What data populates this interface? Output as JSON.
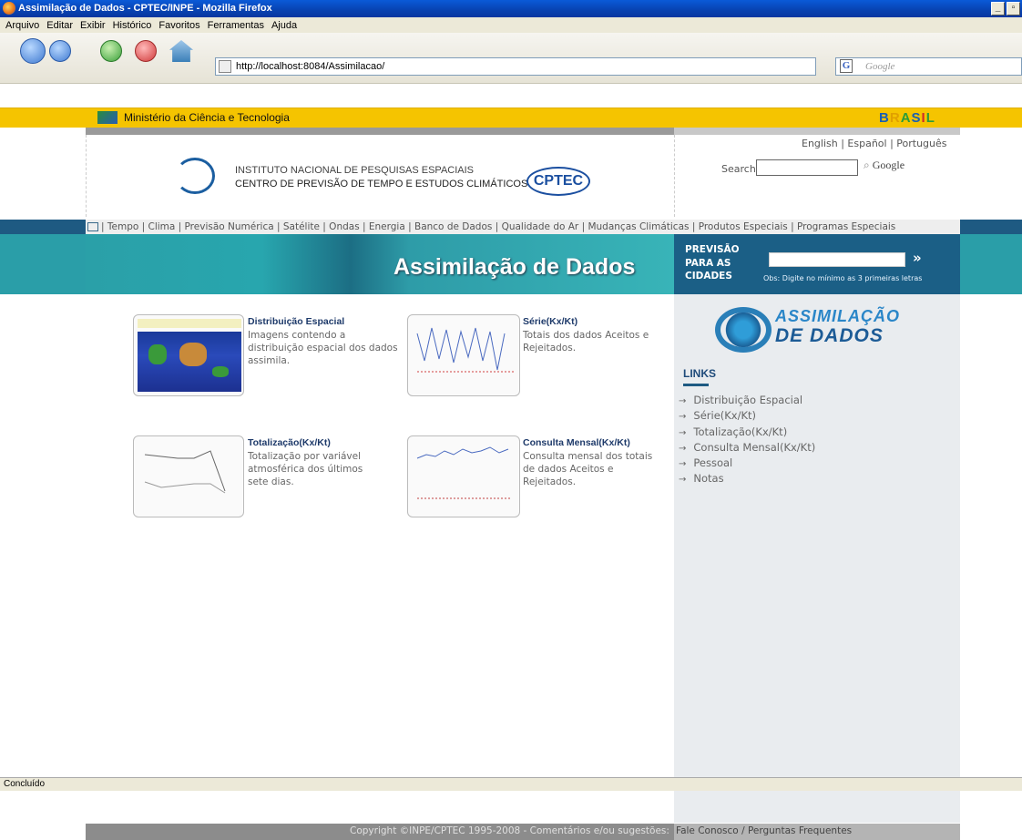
{
  "window": {
    "title": "Assimilação de Dados - CPTEC/INPE - Mozilla Firefox"
  },
  "menu": [
    "Arquivo",
    "Editar",
    "Exibir",
    "Histórico",
    "Favoritos",
    "Ferramentas",
    "Ajuda"
  ],
  "browser": {
    "url": "http://localhost:8084/Assimilacao/",
    "search_placeholder": "Google"
  },
  "gov_bar": {
    "ministry": "Ministério da Ciência e Tecnologia",
    "brasil": "BRASIL"
  },
  "header": {
    "institute_line1": "INSTITUTO NACIONAL DE PESQUISAS ESPACIAIS",
    "institute_line2": "CENTRO DE PREVISÃO DE TEMPO E ESTUDOS CLIMÁTICOS",
    "cptec_logo": "CPTEC",
    "languages": "English | Español | Português",
    "search_label": "Search:",
    "google_label": "Google"
  },
  "topnav": "| Tempo | Clima | Previsão Numérica | Satélite | Ondas | Energia | Banco de Dados | Qualidade do Ar | Mudanças Climáticas | Produtos Especiais | Programas Especiais",
  "banner": {
    "title": "Assimilação de Dados",
    "prev_line1": "PREVISÃO",
    "prev_line2": "PARA AS",
    "prev_line3": "CIDADES",
    "go": "»",
    "obs": "Obs: Digite no mínimo as 3 primeiras letras"
  },
  "cards": [
    {
      "title": "Distribuição Espacial",
      "desc": "Imagens contendo a distribuição espacial dos dados assimila."
    },
    {
      "title": "Série(Kx/Kt)",
      "desc": "Totais dos dados Aceitos e Rejeitados."
    },
    {
      "title": "Totalização(Kx/Kt)",
      "desc": "Totalização por variável atmosférica dos últimos sete dias."
    },
    {
      "title": "Consulta Mensal(Kx/Kt)",
      "desc": "Consulta mensal dos totais de dados Aceitos e Rejeitados."
    }
  ],
  "sidebar": {
    "logo_line1": "ASSIMILAÇÃO",
    "logo_line2": "DE DADOS",
    "links_title": "LINKS",
    "links": [
      "Distribuição Espacial",
      "Série(Kx/Kt)",
      "Totalização(Kx/Kt)",
      "Consulta Mensal(Kx/Kt)",
      "Pessoal",
      "Notas"
    ]
  },
  "footer": {
    "copyright": "Copyright ©INPE/CPTEC 1995-2008 - Comentários e/ou sugestões:",
    "contact": "Fale Conosco / Perguntas Frequentes"
  },
  "status": "Concluído"
}
